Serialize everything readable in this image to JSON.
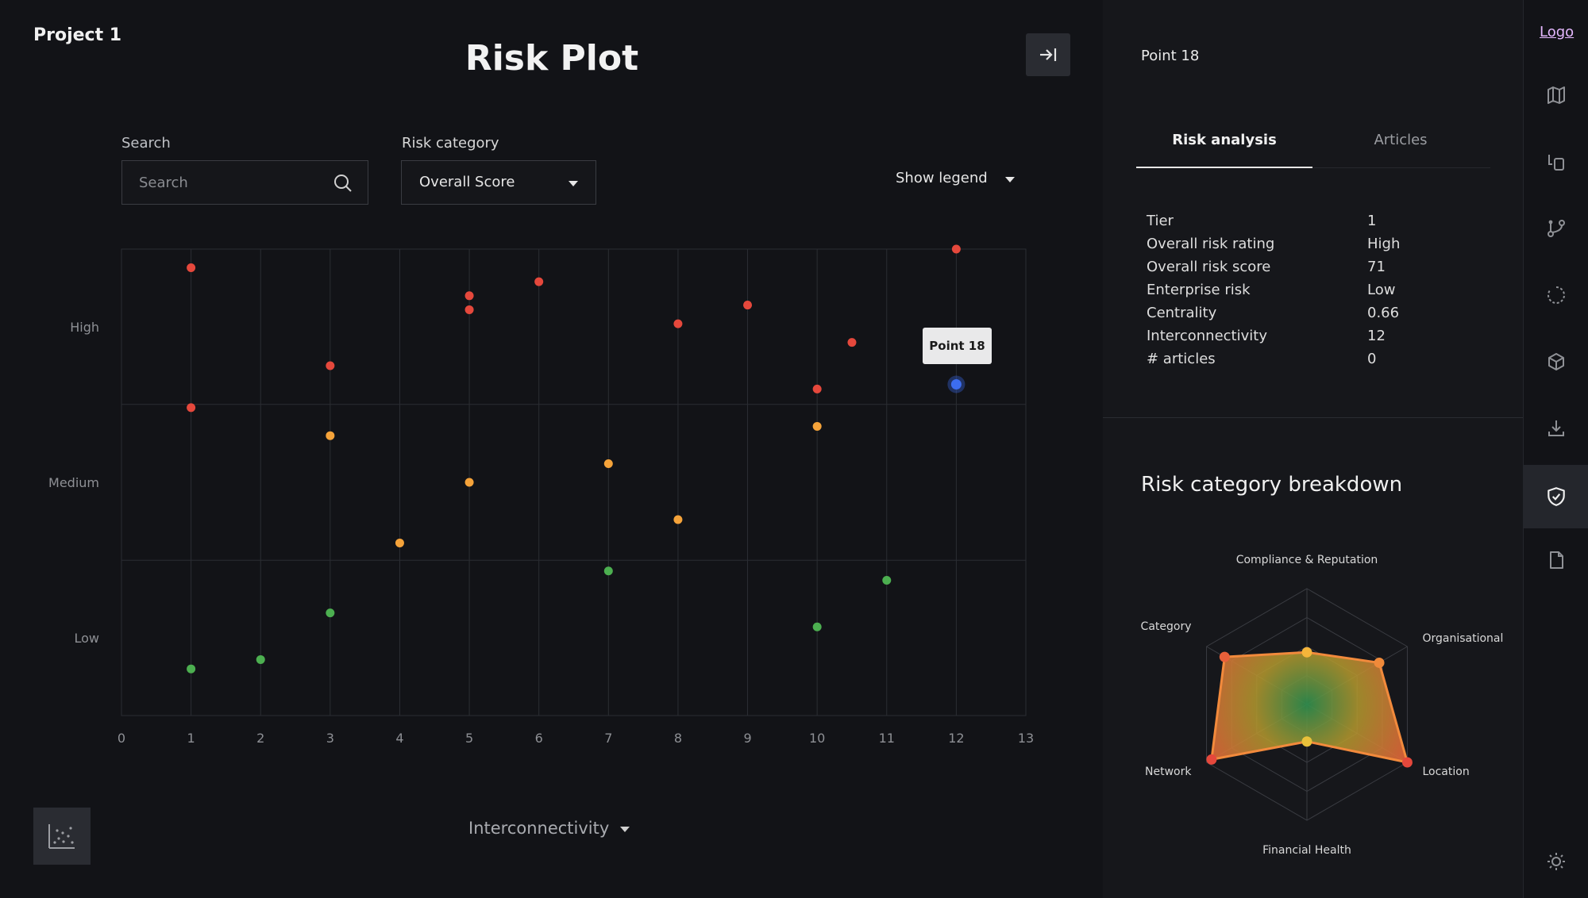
{
  "project": {
    "title": "Project 1"
  },
  "plot": {
    "title": "Risk Plot"
  },
  "controls": {
    "search_label": "Search",
    "search_placeholder": "Search",
    "risk_category_label": "Risk category",
    "risk_category_value": "Overall Score",
    "show_legend_label": "Show legend",
    "x_axis_selector": "Interconnectivity"
  },
  "tooltip": {
    "text": "Point 18"
  },
  "chart_data": {
    "type": "scatter",
    "title": "Risk Plot",
    "xlabel": "Interconnectivity",
    "ylabel": "",
    "xlim": [
      0,
      13
    ],
    "ylim": [
      0,
      100
    ],
    "x_ticks": [
      "0",
      "1",
      "2",
      "3",
      "4",
      "5",
      "6",
      "7",
      "8",
      "9",
      "10",
      "11",
      "12",
      "13"
    ],
    "y_bands": [
      {
        "label": "Low",
        "range": [
          0,
          33.3
        ]
      },
      {
        "label": "Medium",
        "range": [
          33.3,
          66.7
        ]
      },
      {
        "label": "High",
        "range": [
          66.7,
          100
        ]
      }
    ],
    "grid": true,
    "series": [
      {
        "name": "High",
        "color": "#e5483c",
        "points": [
          [
            1,
            96
          ],
          [
            1,
            66
          ],
          [
            3,
            75
          ],
          [
            5,
            90
          ],
          [
            5,
            87
          ],
          [
            6,
            93
          ],
          [
            8,
            84
          ],
          [
            9,
            88
          ],
          [
            10,
            70
          ],
          [
            10.5,
            80
          ],
          [
            12,
            100
          ]
        ]
      },
      {
        "name": "Medium",
        "color": "#f5a33a",
        "points": [
          [
            3,
            60
          ],
          [
            4,
            37
          ],
          [
            5,
            50
          ],
          [
            7,
            54
          ],
          [
            8,
            42
          ],
          [
            10,
            62
          ]
        ]
      },
      {
        "name": "Low",
        "color": "#4caf50",
        "points": [
          [
            1,
            10
          ],
          [
            2,
            12
          ],
          [
            3,
            22
          ],
          [
            7,
            31
          ],
          [
            10,
            19
          ],
          [
            11,
            29
          ]
        ]
      },
      {
        "name": "Selected",
        "color": "#3c6df0",
        "points": [
          [
            12,
            71
          ]
        ]
      }
    ]
  },
  "panel": {
    "point_title": "Point 18",
    "tabs": [
      "Risk analysis",
      "Articles"
    ],
    "details": [
      {
        "key": "Tier",
        "value": "1"
      },
      {
        "key": "Overall risk rating",
        "value": "High"
      },
      {
        "key": "Overall risk score",
        "value": "71"
      },
      {
        "key": "Enterprise risk",
        "value": "Low"
      },
      {
        "key": "Centrality",
        "value": "0.66"
      },
      {
        "key": "Interconnectivity",
        "value": "12"
      },
      {
        "key": "# articles",
        "value": "0"
      }
    ],
    "breakdown_title": "Risk category breakdown",
    "radar": {
      "axes": [
        "Compliance & Reputation",
        "Organisational",
        "Location",
        "Financial Health",
        "Network",
        "Category"
      ],
      "values": [
        0.45,
        0.72,
        1.0,
        0.32,
        0.95,
        0.82
      ],
      "point_colors": [
        "#f5b53a",
        "#f08a3a",
        "#e5483c",
        "#e9c13a",
        "#e5483c",
        "#e8603a"
      ]
    }
  },
  "rail": {
    "logo": "Logo",
    "icons": [
      "map-icon",
      "copy-icon",
      "git-branch-icon",
      "loading-icon",
      "cube-icon",
      "download-icon",
      "shield-check-icon",
      "document-icon",
      "sun-icon"
    ]
  },
  "colors": {
    "accent": "#e5b8ff",
    "high": "#e5483c",
    "medium": "#f5a33a",
    "low": "#4caf50",
    "selected": "#3c6df0"
  }
}
